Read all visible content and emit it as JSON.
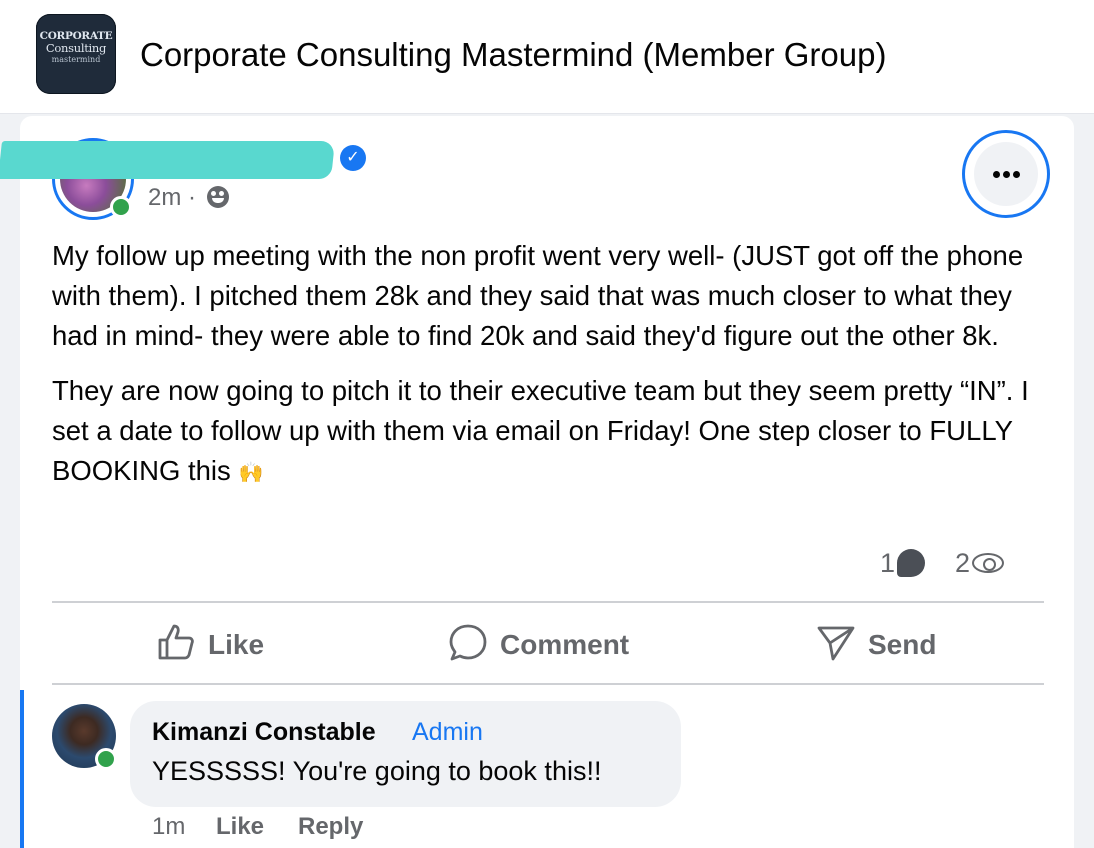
{
  "header": {
    "group_title": "Corporate Consulting Mastermind (Member Group)",
    "logo": {
      "line1": "CORPORATE",
      "line2": "Consulting",
      "line3": "mastermind"
    }
  },
  "post": {
    "author_name_visible": false,
    "verified_icon": "verified-badge-icon",
    "timestamp": "2m",
    "separator": "·",
    "audience_icon": "group-audience-icon",
    "paragraphs": [
      "My follow up meeting with the non profit went very well- (JUST got off the phone with them). I pitched them 28k and they said that was much closer to what they had in mind- they were able to find 20k and said they'd figure out the other 8k.",
      "They are now going to pitch it to their executive team but they seem pretty “IN”. I set a date to follow up with them via email on Friday! One step closer to FULLY BOOKING this"
    ],
    "emoji": "🙌",
    "comment_count": "1",
    "view_count": "2"
  },
  "actions": {
    "like": "Like",
    "comment": "Comment",
    "send": "Send"
  },
  "comment": {
    "author": "Kimanzi Constable",
    "role": "Admin",
    "text": "YESSSSS! You're going to book this!!",
    "time": "1m",
    "like": "Like",
    "reply": "Reply"
  },
  "colors": {
    "accent": "#1877f2",
    "online": "#31a24c",
    "secondary_text": "#65676b",
    "redaction": "#59d8cf"
  }
}
